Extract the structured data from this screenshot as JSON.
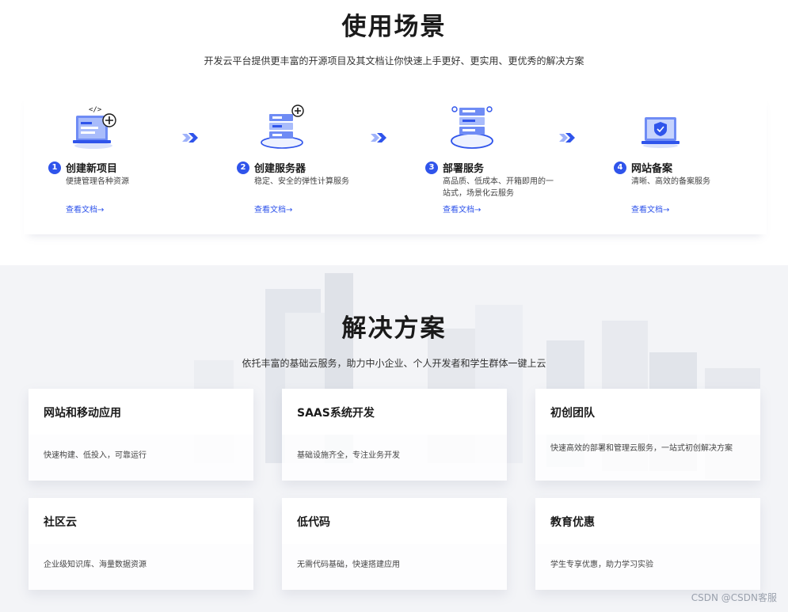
{
  "scenes": {
    "title": "使用场景",
    "subtitle": "开发云平台提供更丰富的开源项目及其文档让你快速上手更好、更实用、更优秀的解决方案",
    "items": [
      {
        "num": "1",
        "name": "创建新项目",
        "desc": "便捷管理各种资源",
        "link": "查看文档→",
        "icon": "code-monitor-add-icon"
      },
      {
        "num": "2",
        "name": "创建服务器",
        "desc": "稳定、安全的弹性计算服务",
        "link": "查看文档→",
        "icon": "server-add-icon"
      },
      {
        "num": "3",
        "name": "部署服务",
        "desc": "高品质、低成本、开箱即用的一站式，场景化云服务",
        "link": "查看文档→",
        "icon": "server-stack-icon"
      },
      {
        "num": "4",
        "name": "网站备案",
        "desc": "清晰、高效的备案服务",
        "link": "查看文档→",
        "icon": "shield-monitor-icon"
      }
    ]
  },
  "solutions": {
    "title": "解决方案",
    "subtitle": "依托丰富的基础云服务，助力中小企业、个人开发者和学生群体一键上云",
    "cards": [
      {
        "title": "网站和移动应用",
        "desc": "快速构建、低投入，可靠运行"
      },
      {
        "title": "SAAS系统开发",
        "desc": "基础设施齐全，专注业务开发"
      },
      {
        "title": "初创团队",
        "desc": "快速高效的部署和管理云服务，一站式初创解决方案"
      },
      {
        "title": "社区云",
        "desc": "企业级知识库、海量数据资源"
      },
      {
        "title": "低代码",
        "desc": "无需代码基础，快速搭建应用"
      },
      {
        "title": "教育优惠",
        "desc": "学生专享优惠，助力学习实验"
      }
    ]
  },
  "watermark": "CSDN @CSDN客服",
  "colors": {
    "accent": "#2f54eb",
    "section_bg": "#f3f4f7"
  }
}
